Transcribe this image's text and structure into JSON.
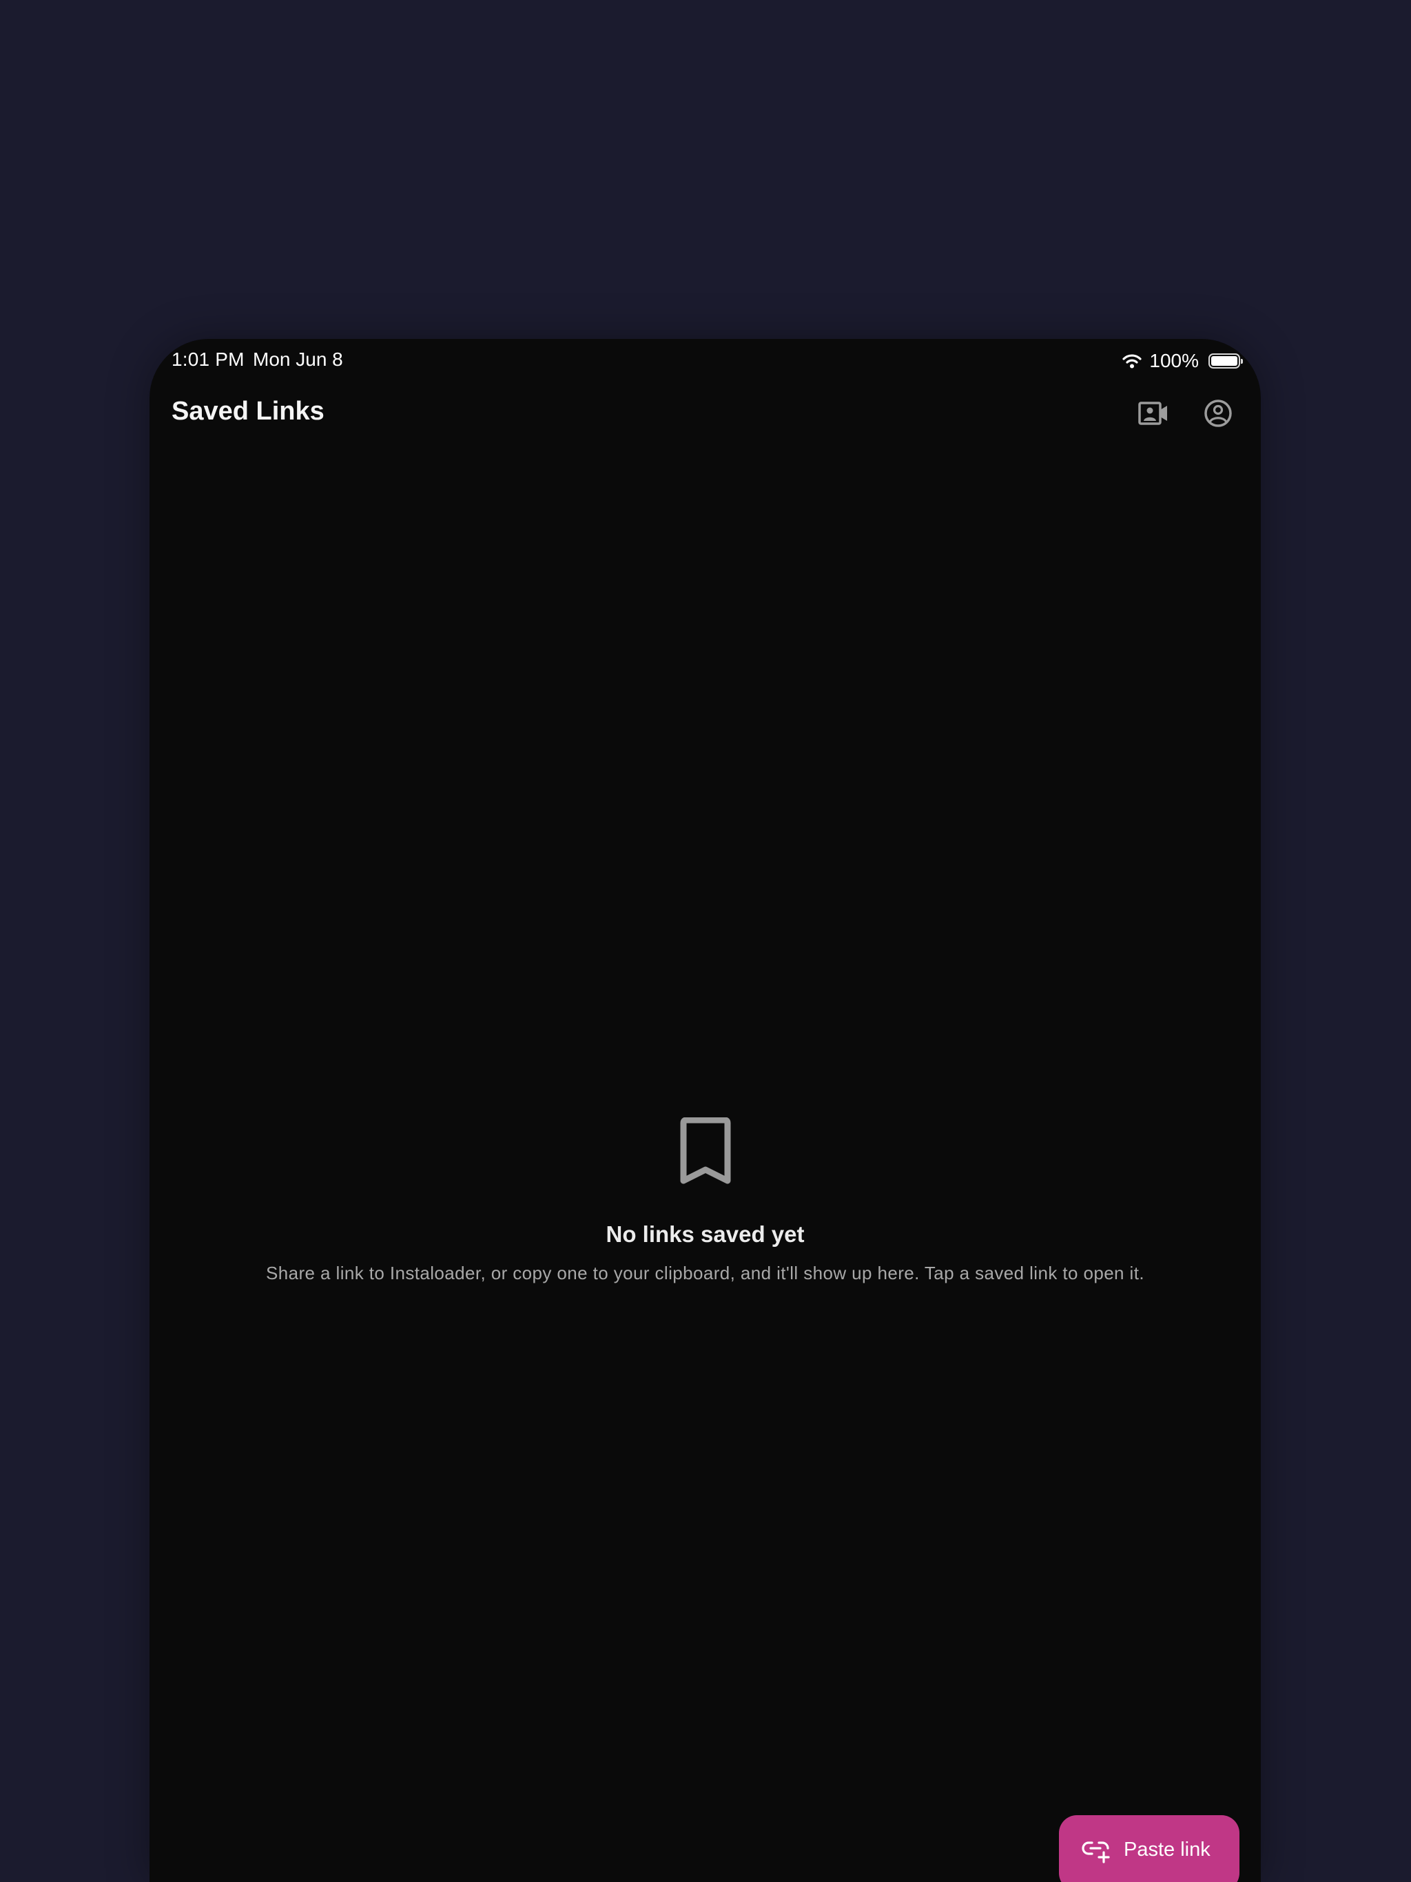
{
  "status_bar": {
    "time": "1:01 PM",
    "date": "Mon Jun 8",
    "battery_percent": "100%",
    "battery_level": 1.0,
    "wifi_icon": "wifi-icon",
    "battery_icon": "battery-icon"
  },
  "header": {
    "title": "Saved Links",
    "actions": [
      {
        "icon": "video-account-icon"
      },
      {
        "icon": "account-circle-icon"
      }
    ]
  },
  "empty_state": {
    "icon": "bookmark-outline-icon",
    "title": "No links saved yet",
    "description": "Share a link to Instaloader, or copy one to your clipboard, and it'll show up here. Tap a saved link to open it."
  },
  "fab": {
    "label": "Paste link",
    "icon": "add-link-icon"
  },
  "colors": {
    "page_background": "#1b1b2e",
    "app_background": "#0a0a0a",
    "accent": "#c03786",
    "muted_text": "#a8a8a8"
  }
}
